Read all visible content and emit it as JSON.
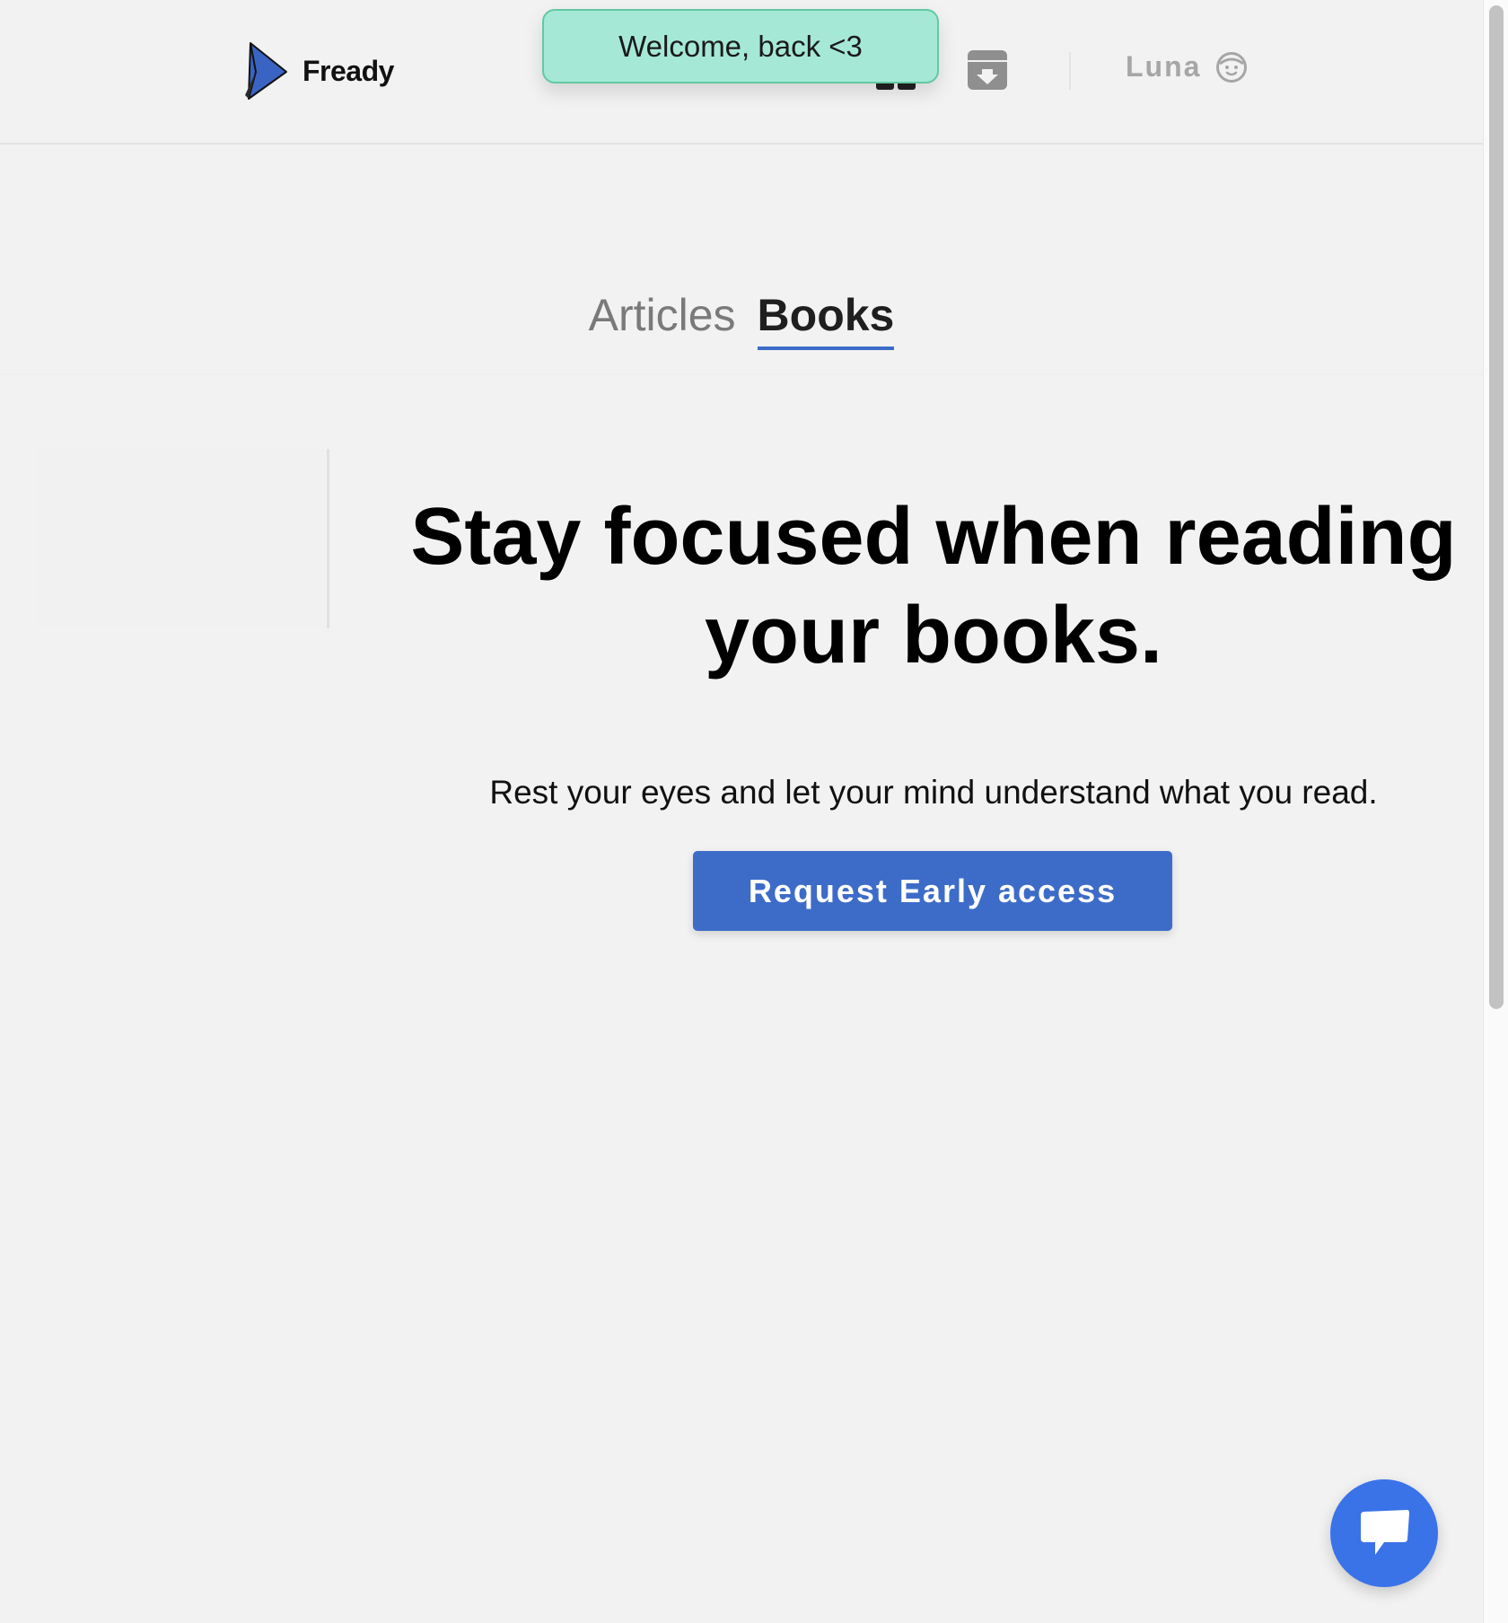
{
  "app": {
    "name": "Fready"
  },
  "header": {
    "logo_text": "Fready",
    "user": {
      "name": "Luna"
    },
    "icons": [
      "grid-icon",
      "archive-download-icon",
      "user-face-icon"
    ]
  },
  "toast": {
    "message": "Welcome, back <3"
  },
  "tabs": [
    {
      "label": "Articles",
      "active": false
    },
    {
      "label": "Books",
      "active": true
    }
  ],
  "hero": {
    "title": "Stay focused when reading your books.",
    "subtitle": "Rest your eyes and let your mind understand what you read.",
    "cta_label": "Request Early access"
  },
  "chat": {
    "icon": "chat-bubble-icon"
  },
  "colors": {
    "accent": "#3d6cc8",
    "chat_accent": "#3a72e8",
    "toast_bg": "#a6e8d6",
    "toast_border": "#63c9a3",
    "background": "#f2f2f2"
  }
}
